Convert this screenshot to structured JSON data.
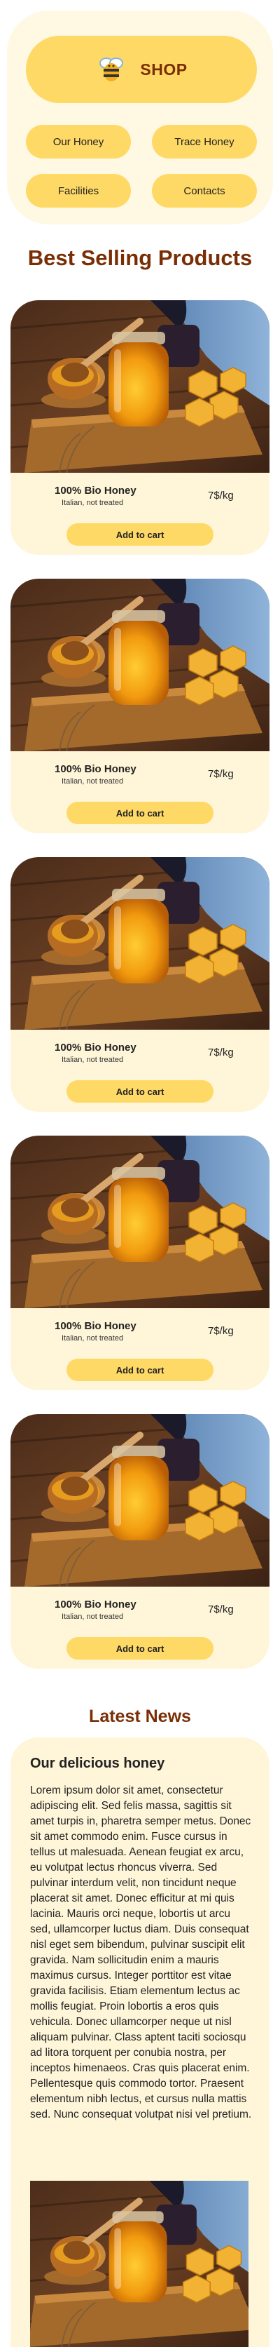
{
  "nav": {
    "shop_label": "SHOP",
    "links": [
      "Our Honey",
      "Trace Honey",
      "Facilities",
      "Contacts"
    ]
  },
  "best_selling": {
    "title": "Best Selling Products",
    "products": [
      {
        "name": "100% Bio Honey",
        "desc": "Italian, not treated",
        "price": "7$/kg",
        "cta": "Add to cart"
      },
      {
        "name": "100% Bio Honey",
        "desc": "Italian, not treated",
        "price": "7$/kg",
        "cta": "Add to cart"
      },
      {
        "name": "100% Bio Honey",
        "desc": "Italian, not treated",
        "price": "7$/kg",
        "cta": "Add to cart"
      },
      {
        "name": "100% Bio Honey",
        "desc": "Italian, not treated",
        "price": "7$/kg",
        "cta": "Add to cart"
      },
      {
        "name": "100% Bio Honey",
        "desc": "Italian, not treated",
        "price": "7$/kg",
        "cta": "Add to cart"
      }
    ]
  },
  "news": {
    "title": "Latest News",
    "article_title": "Our delicious honey",
    "article_body": "Lorem ipsum dolor sit amet, consectetur adipiscing elit. Sed felis massa, sagittis sit amet turpis in, pharetra semper metus. Donec sit amet commodo enim. Fusce cursus in tellus ut malesuada. Aenean feugiat ex arcu, eu volutpat lectus rhoncus viverra. Sed pulvinar interdum velit, non tincidunt neque placerat sit amet. Donec efficitur at mi quis lacinia. Mauris orci neque, lobortis ut arcu sed, ullamcorper luctus diam. Duis consequat nisl eget sem bibendum, pulvinar suscipit elit gravida. Nam sollicitudin enim a mauris maximus cursus. Integer porttitor est vitae gravida facilisis. Etiam elementum lectus ac mollis feugiat. Proin lobortis a eros quis vehicula. Donec ullamcorper neque ut nisl aliquam pulvinar. Class aptent taciti sociosqu ad litora torquent per conubia nostra, per inceptos himenaeos. Cras quis placerat enim. Pellentesque quis commodo tortor. Praesent elementum nibh lectus, et cursus nulla mattis sed. Nunc consequat volutpat nisi vel pretium."
  }
}
